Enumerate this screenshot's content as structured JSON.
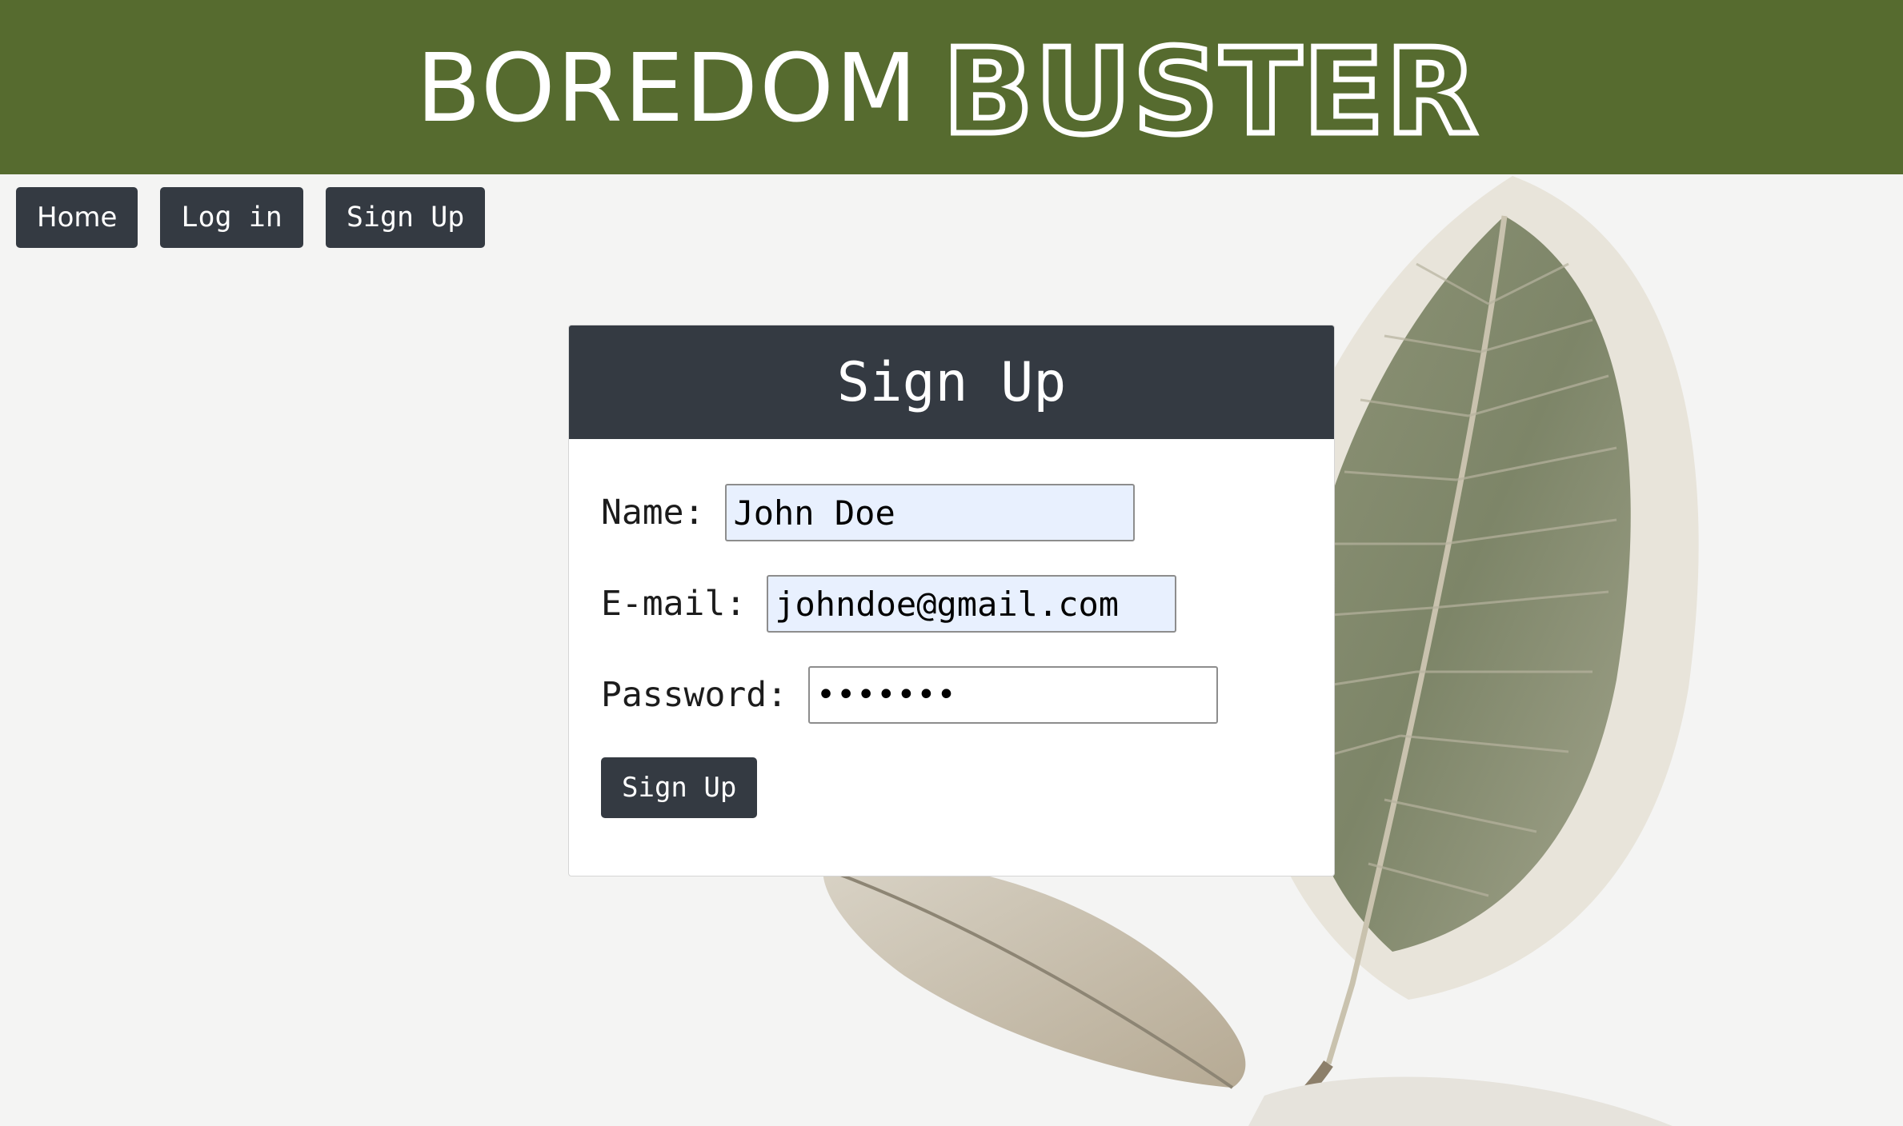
{
  "header": {
    "brand_plain": "BOREDOM",
    "brand_logo": "BUSTER",
    "background_color": "#566b2f"
  },
  "nav": {
    "items": [
      {
        "label": "Home"
      },
      {
        "label": "Log in"
      },
      {
        "label": "Sign Up"
      }
    ]
  },
  "form": {
    "title": "Sign Up",
    "name_label": "Name:",
    "name_value": "John Doe",
    "email_label": "E-mail:",
    "email_value": "johndoe@gmail.com",
    "password_label": "Password:",
    "password_value": "1234567",
    "submit_label": "Sign Up"
  },
  "colors": {
    "header_green": "#566b2f",
    "dark_button": "#343a42",
    "autofill_blue": "#e8f0fe"
  },
  "background": {
    "image_icon": "rubber-plant-leaf-icon"
  }
}
